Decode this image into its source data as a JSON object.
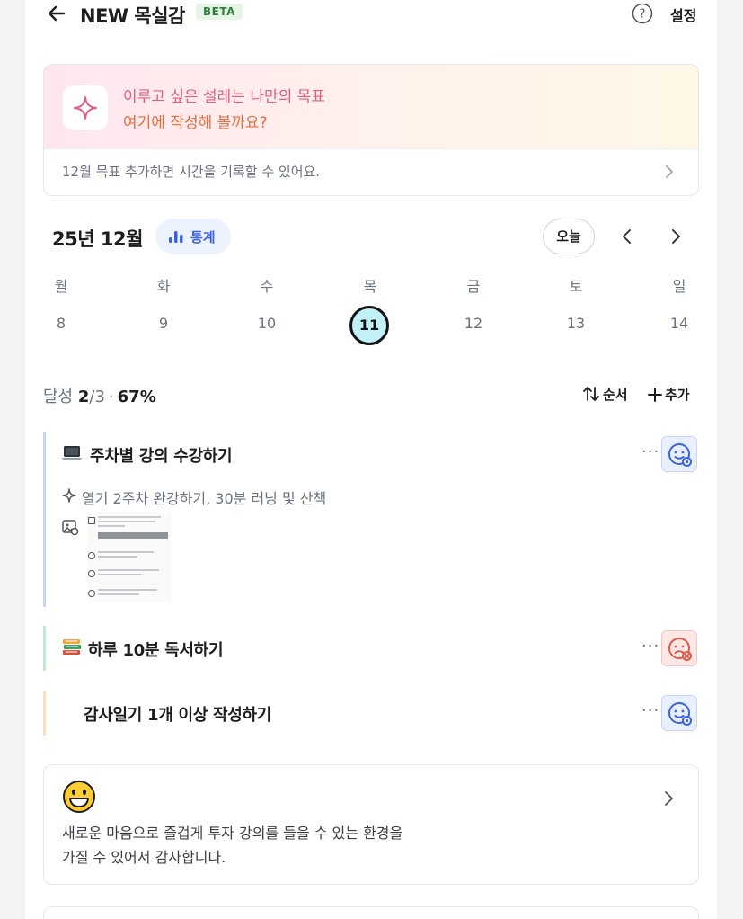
{
  "header": {
    "title": "NEW 목실감",
    "badge": "BETA",
    "settings": "설정"
  },
  "goal": {
    "line1": "이루고 싶은 설레는 나만의 목표",
    "line2": "여기에 작성해 볼까요?",
    "hint": "12월 목표  추가하면 시간을 기록할 수 있어요."
  },
  "calendar": {
    "month": "25년 12월",
    "stats_label": "통계",
    "today_label": "오늘",
    "weekdays": [
      "월",
      "화",
      "수",
      "목",
      "금",
      "토",
      "일"
    ],
    "dates": [
      "8",
      "9",
      "10",
      "11",
      "12",
      "13",
      "14"
    ],
    "selected_date": "11"
  },
  "summary": {
    "label": "달성",
    "done": "2",
    "total": "/3",
    "percent": "67%",
    "order": "순서",
    "add": "추가"
  },
  "tasks": [
    {
      "icon": "laptop-icon",
      "name": "주차별 강의 수강하기",
      "detail": "열기 2주차 완강하기, 30분 러닝 및 산책",
      "bar_color": "#c9d3f5",
      "status": "smile"
    },
    {
      "icon": "books-icon",
      "name": "하루 10분 독서하기",
      "bar_color": "#bfe8cf",
      "status": "sad"
    },
    {
      "name": "감사일기 1개 이상 작성하기",
      "bar_color": "#fbe0c0",
      "status": "smile"
    }
  ],
  "gratitude": {
    "emoji": "grinning-face-icon",
    "line1": "새로운 마음으로 즐겁게 투자 강의를 들을 수 있는 환경을",
    "line2": "가질 수 있어서 감사합니다."
  },
  "colors": {
    "accent_blue": "#3b63e0",
    "sad_red": "#e0584a",
    "selected_day": "#c2f0f7"
  }
}
